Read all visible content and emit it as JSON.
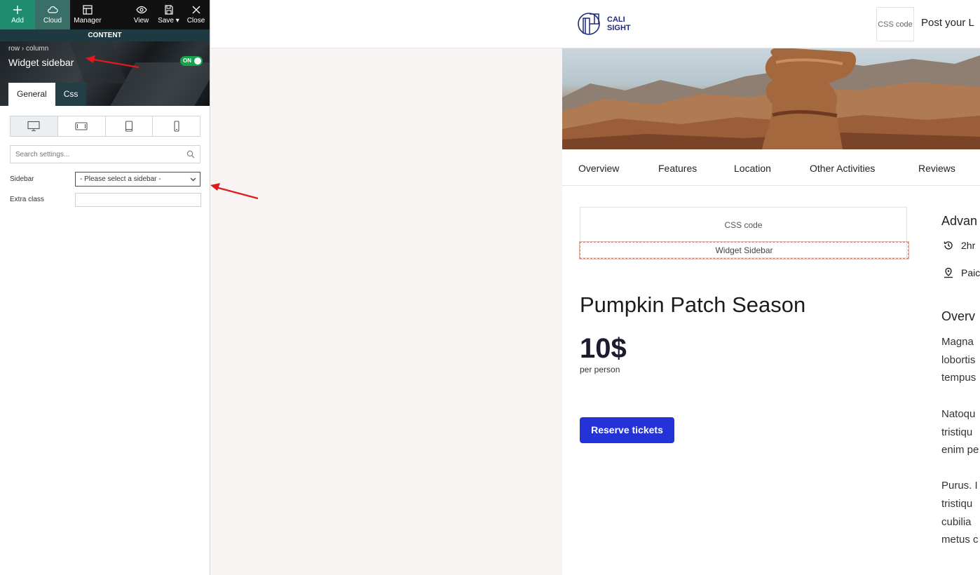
{
  "toolbar": {
    "add": "Add",
    "cloud": "Cloud",
    "manager": "Manager",
    "view": "View",
    "save": "Save",
    "close": "Close"
  },
  "panel": {
    "section_label": "CONTENT",
    "breadcrumb_row": "row",
    "breadcrumb_sep": "›",
    "breadcrumb_column": "column",
    "title": "Widget sidebar",
    "toggle_label": "ON",
    "tabs": [
      "General",
      "Css"
    ],
    "search_placeholder": "Search settings...",
    "sidebar_label": "Sidebar",
    "sidebar_value": "- Please select a sidebar -",
    "extra_class_label": "Extra class",
    "extra_class_value": ""
  },
  "preview": {
    "logo_line1": "CALI",
    "logo_line2": "SIGHT",
    "css_code_button": "CSS code",
    "post_link": "Post your L",
    "nav": [
      "Overview",
      "Features",
      "Location",
      "Other Activities",
      "Reviews"
    ],
    "css_box_label": "CSS code",
    "widget_box_label": "Widget Sidebar",
    "event_title": "Pumpkin Patch Season",
    "price": "10$",
    "price_note": "per person",
    "reserve_button": "Reserve tickets",
    "side_heading_1": "Advan",
    "side_duration": "2hr",
    "side_location": "Paic",
    "side_heading_2": "Overv",
    "paragraph_lines": [
      "Magna",
      "lobortis",
      "tempus",
      "Natoqu",
      "tristiqu",
      "enim pe",
      "Purus. I",
      "tristiqu",
      "cubilia",
      "metus c"
    ]
  },
  "colors": {
    "accent_blue": "#2433d8",
    "toggle_green": "#16a34a",
    "toolbar_add": "#1e8c6e",
    "annotation_red": "#e0191f"
  }
}
